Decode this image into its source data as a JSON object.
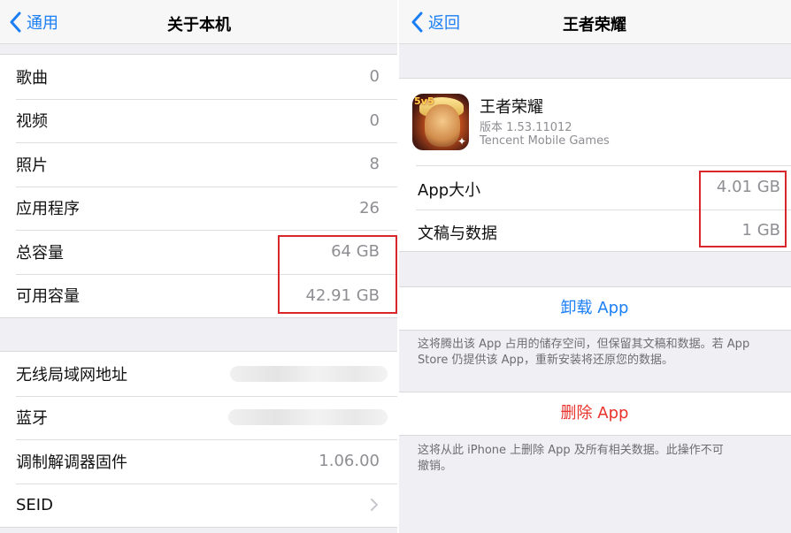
{
  "left": {
    "nav": {
      "back_label": "通用",
      "title": "关于本机"
    },
    "group1": [
      {
        "label": "歌曲",
        "value": "0"
      },
      {
        "label": "视频",
        "value": "0"
      },
      {
        "label": "照片",
        "value": "8"
      },
      {
        "label": "应用程序",
        "value": "26"
      },
      {
        "label": "总容量",
        "value": "64 GB"
      },
      {
        "label": "可用容量",
        "value": "42.91 GB"
      }
    ],
    "group2": [
      {
        "label": "无线局域网地址",
        "value": ""
      },
      {
        "label": "蓝牙",
        "value": ""
      },
      {
        "label": "调制解调器固件",
        "value": "1.06.00"
      },
      {
        "label": "SEID",
        "value": ""
      }
    ]
  },
  "right": {
    "nav": {
      "back_label": "返回",
      "title": "王者荣耀"
    },
    "app": {
      "icon_badge": "5v5",
      "name": "王者荣耀",
      "version": "版本 1.53.11012",
      "developer": "Tencent Mobile Games"
    },
    "storage": [
      {
        "label": "App大小",
        "value": "4.01 GB"
      },
      {
        "label": "文稿与数据",
        "value": "1 GB"
      }
    ],
    "offload": {
      "label": "卸载 App",
      "note": "这将腾出该 App 占用的储存空间，但保留其文稿和数据。若 App Store 仍提供该 App，重新安装将还原您的数据。"
    },
    "delete": {
      "label": "删除 App",
      "note": "这将从此 iPhone 上删除 App 及所有相关数据。此操作不可撤销。"
    }
  },
  "colors": {
    "accent_blue": "#1a7ef5",
    "destructive_red": "#e8322b",
    "highlight_red": "#d9262b",
    "background_gray": "#efeff4"
  },
  "icons": [
    "chevron-left-icon",
    "chevron-right-icon",
    "app-icon"
  ]
}
